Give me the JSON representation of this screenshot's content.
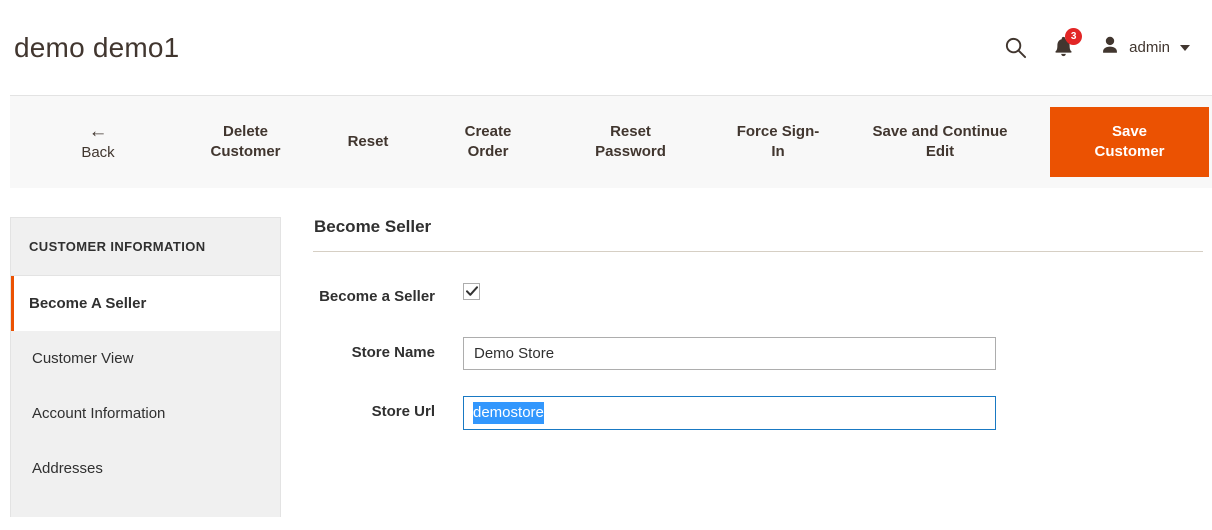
{
  "header": {
    "title": "demo demo1",
    "search_icon": "search-icon",
    "notifications": {
      "icon": "bell-icon",
      "count": "3"
    },
    "user": {
      "icon": "user-avatar-icon",
      "name": "admin",
      "caret": "chevron-down-icon"
    }
  },
  "toolbar": {
    "back": {
      "arrow": "←",
      "label": "Back"
    },
    "delete_customer": "Delete\nCustomer",
    "delete_customer_line1": "Delete",
    "delete_customer_line2": "Customer",
    "reset": "Reset",
    "create_order_line1": "Create",
    "create_order_line2": "Order",
    "reset_password_line1": "Reset",
    "reset_password_line2": "Password",
    "force_sign_in_line1": "Force Sign-",
    "force_sign_in_line2": "In",
    "save_continue_line1": "Save and Continue",
    "save_continue_line2": "Edit",
    "save_customer_line1": "Save",
    "save_customer_line2": "Customer"
  },
  "sidebar": {
    "title": "CUSTOMER INFORMATION",
    "items": [
      {
        "label": "Become A Seller",
        "active": true
      },
      {
        "label": "Customer View",
        "active": false
      },
      {
        "label": "Account Information",
        "active": false
      },
      {
        "label": "Addresses",
        "active": false
      }
    ]
  },
  "main": {
    "section_title": "Become Seller",
    "fields": {
      "become_seller": {
        "label": "Become a Seller",
        "checked": true
      },
      "store_name": {
        "label": "Store Name",
        "value": "Demo Store",
        "placeholder": ""
      },
      "store_url": {
        "label": "Store Url",
        "value": "demostore",
        "placeholder": "",
        "selected": true,
        "focused": true
      }
    }
  },
  "colors": {
    "accent_orange": "#eb5202",
    "badge_red": "#e22626",
    "focus_blue": "#1979c3",
    "selection_blue": "#3297fd",
    "toolbar_bg": "#f8f8f8",
    "sidebar_bg": "#f0f0f0",
    "border_gray": "#e3e3e3",
    "text_dark": "#303030"
  }
}
